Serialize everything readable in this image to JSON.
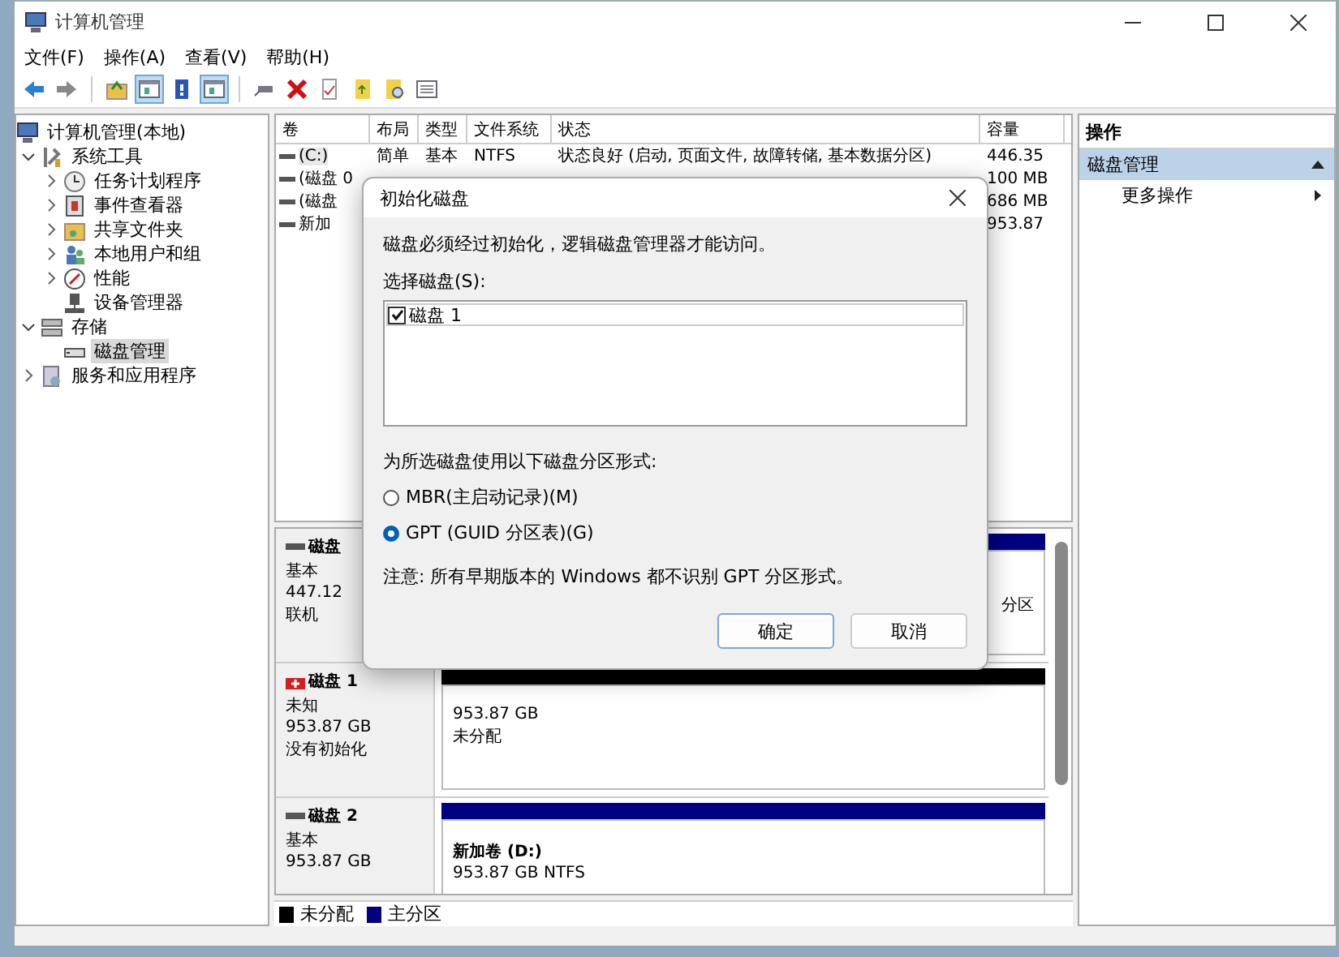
{
  "window": {
    "title": "计算机管理"
  },
  "menu": [
    "文件(F)",
    "操作(A)",
    "查看(V)",
    "帮助(H)"
  ],
  "toolbar": [
    {
      "kind": "back",
      "pressed": false
    },
    {
      "kind": "forward",
      "pressed": false
    },
    {
      "kind": "separator"
    },
    {
      "kind": "up",
      "pressed": false
    },
    {
      "kind": "pane",
      "pressed": true
    },
    {
      "kind": "help",
      "pressed": false
    },
    {
      "kind": "pane",
      "pressed": true
    },
    {
      "kind": "separator"
    },
    {
      "kind": "connect",
      "pressed": false
    },
    {
      "kind": "delete",
      "pressed": false
    },
    {
      "kind": "check",
      "pressed": false
    },
    {
      "kind": "folder",
      "pressed": false
    },
    {
      "kind": "search",
      "pressed": false
    },
    {
      "kind": "list",
      "pressed": false
    }
  ],
  "tree": [
    {
      "label": "计算机管理(本地)",
      "kind": "computer",
      "selected": false,
      "children": [
        {
          "label": "系统工具",
          "kind": "tools",
          "expanded": true,
          "selected": false,
          "children": [
            {
              "label": "任务计划程序",
              "kind": "clock",
              "expanded": false,
              "selected": false
            },
            {
              "label": "事件查看器",
              "kind": "events",
              "expanded": false,
              "selected": false
            },
            {
              "label": "共享文件夹",
              "kind": "share",
              "expanded": false,
              "selected": false
            },
            {
              "label": "本地用户和组",
              "kind": "users",
              "expanded": false,
              "selected": false
            },
            {
              "label": "性能",
              "kind": "perf",
              "expanded": false,
              "selected": false
            },
            {
              "label": "设备管理器",
              "kind": "device",
              "selected": false
            }
          ]
        },
        {
          "label": "存储",
          "kind": "storage",
          "expanded": true,
          "selected": false,
          "children": [
            {
              "label": "磁盘管理",
              "kind": "disk",
              "selected": true
            }
          ]
        },
        {
          "label": "服务和应用程序",
          "kind": "services",
          "expanded": false,
          "selected": false
        }
      ]
    }
  ],
  "volumes": {
    "columns": [
      "卷",
      "布局",
      "类型",
      "文件系统",
      "状态",
      "容量"
    ],
    "rows": [
      {
        "volume": "(C:)",
        "layout": "简单",
        "type": "基本",
        "file_system": "NTFS",
        "status": "状态良好 (启动, 页面文件, 故障转储, 基本数据分区)",
        "capacity": "446.35",
        "selected": true
      },
      {
        "volume": "(磁盘 0",
        "capacity": "100 MB",
        "selected": false
      },
      {
        "volume": "(磁盘",
        "capacity": "686 MB",
        "selected": false
      },
      {
        "volume": "新加",
        "capacity": "953.87",
        "selected": false
      }
    ]
  },
  "disks": [
    {
      "name": "磁盘",
      "kind": "basic",
      "type": "基本",
      "size": "447.12",
      "state": "联机",
      "partitions": [
        {
          "kind": "primary",
          "lines": [
            "分区"
          ]
        }
      ]
    },
    {
      "name": "磁盘 1",
      "kind": "unknown",
      "type": "未知",
      "size": "953.87 GB",
      "state": "没有初始化",
      "partitions": [
        {
          "kind": "unallocated",
          "lines": [
            "953.87 GB",
            "未分配"
          ]
        }
      ]
    },
    {
      "name": "磁盘 2",
      "kind": "basic",
      "type": "基本",
      "size": "953.87 GB",
      "partitions": [
        {
          "kind": "primary",
          "title": "新加卷 (D:)",
          "lines": [
            "953.87 GB NTFS"
          ]
        }
      ]
    }
  ],
  "legend": [
    {
      "label": "未分配",
      "color": "#000000"
    },
    {
      "label": "主分区",
      "color": "#000080"
    }
  ],
  "actions": {
    "title": "操作",
    "section": {
      "label": "磁盘管理",
      "expanded": true
    },
    "items": [
      {
        "label": "更多操作"
      }
    ]
  },
  "dialog": {
    "title": "初始化磁盘",
    "message": "磁盘必须经过初始化，逻辑磁盘管理器才能访问。",
    "list_label": "选择磁盘(S):",
    "disks": [
      {
        "label": "磁盘 1",
        "checked": true
      }
    ],
    "style_label": "为所选磁盘使用以下磁盘分区形式:",
    "options": [
      {
        "label": "MBR(主启动记录)(M)",
        "selected": false
      },
      {
        "label": "GPT (GUID 分区表)(G)",
        "selected": true
      }
    ],
    "note": "注意: 所有早期版本的 Windows 都不识别 GPT 分区形式。",
    "buttons": [
      {
        "label": "确定",
        "default": true
      },
      {
        "label": "取消",
        "default": false
      }
    ]
  }
}
